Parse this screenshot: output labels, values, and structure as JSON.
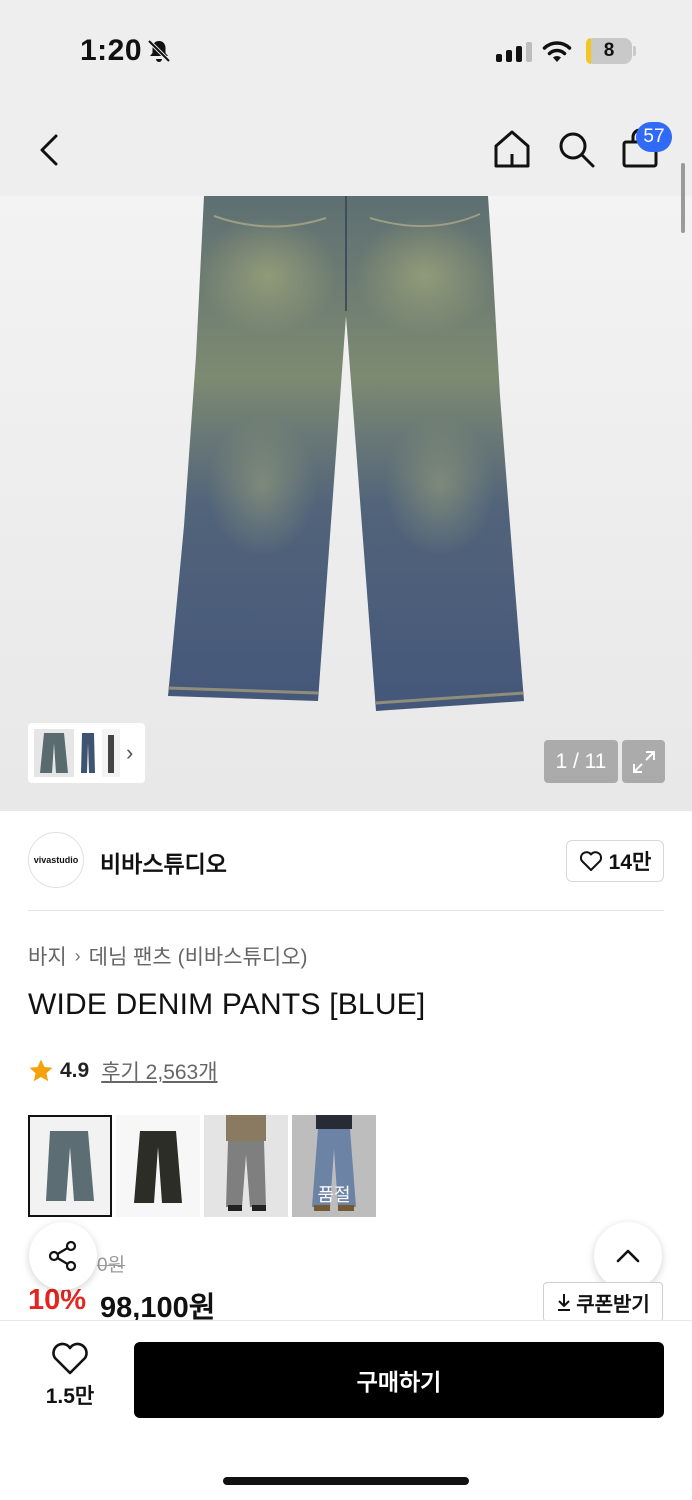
{
  "status_bar": {
    "time": "1:20",
    "battery": "8",
    "battery_level": 0.08
  },
  "header": {
    "cart_count": "57"
  },
  "gallery": {
    "page_indicator": "1 / 11"
  },
  "brand": {
    "logo_text": "vivastudio",
    "name": "비바스튜디오",
    "like_count": "14만"
  },
  "breadcrumb": {
    "category": "바지",
    "subcategory": "데님 팬츠 (비바스튜디오)"
  },
  "product": {
    "title": "WIDE DENIM PANTS [BLUE]",
    "rating": "4.9",
    "review_link": "후기 2,563개",
    "original_price_partial": "0원",
    "discount": "10%",
    "price": "98,100원"
  },
  "options": [
    {
      "name": "blue",
      "selected": true
    },
    {
      "name": "black",
      "selected": false
    },
    {
      "name": "gray",
      "selected": false
    },
    {
      "name": "light-blue",
      "selected": false,
      "sold_out_label": "품절"
    }
  ],
  "coupon": {
    "label": "쿠폰받기"
  },
  "bottom": {
    "like_count": "1.5만",
    "buy_label": "구매하기"
  },
  "colors": {
    "accent_blue": "#2f6bf6",
    "discount_red": "#e3261f",
    "buy_button": "#000000"
  },
  "icons": [
    "bell-off-icon",
    "signal-icon",
    "wifi-icon",
    "battery-icon",
    "back-icon",
    "home-icon",
    "search-icon",
    "bag-icon",
    "chevron-right-icon",
    "expand-icon",
    "heart-icon",
    "star-icon",
    "share-icon",
    "chevron-up-icon",
    "download-icon"
  ]
}
